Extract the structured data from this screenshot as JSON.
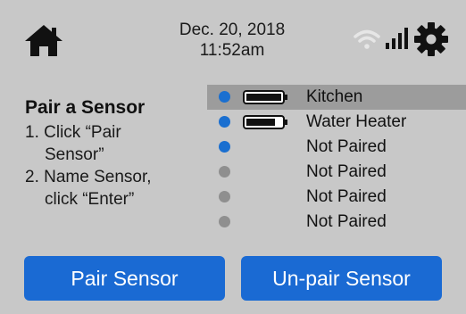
{
  "header": {
    "date": "Dec. 20, 2018",
    "time": "11:52am",
    "icons": {
      "home": "home-icon",
      "wifi": "wifi-icon",
      "signal": "signal-strength-icon",
      "settings": "gear-icon"
    }
  },
  "instructions": {
    "title": "Pair a Sensor",
    "step1_line1": "1. Click “Pair",
    "step1_line2": "Sensor”",
    "step2_line1": "2. Name Sensor,",
    "step2_line2": "click “Enter”"
  },
  "sensors": [
    {
      "name": "Kitchen",
      "paired": true,
      "battery": "full",
      "selected": true
    },
    {
      "name": "Water Heater",
      "paired": true,
      "battery": "high",
      "selected": false
    },
    {
      "name": "Not Paired",
      "paired": true,
      "battery": null,
      "selected": false
    },
    {
      "name": "Not Paired",
      "paired": false,
      "battery": null,
      "selected": false
    },
    {
      "name": "Not Paired",
      "paired": false,
      "battery": null,
      "selected": false
    },
    {
      "name": "Not Paired",
      "paired": false,
      "battery": null,
      "selected": false
    }
  ],
  "buttons": {
    "pair_label": "Pair Sensor",
    "unpair_label": "Un-pair Sensor"
  },
  "colors": {
    "background": "#c8c8c8",
    "accent_blue": "#1a6ad3",
    "selected_row": "#9c9c9c",
    "unpaired_dot": "#8f8f8f"
  }
}
